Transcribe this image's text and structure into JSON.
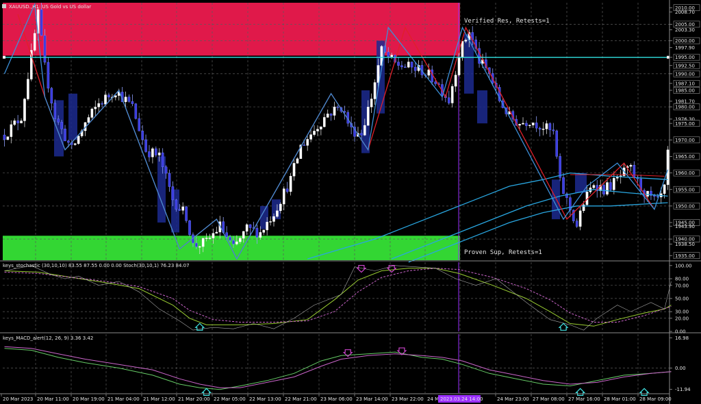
{
  "header": {
    "title": "XAUUSD.,H1:  US Gold vs US dollar",
    "stoch_title": "keys_stochastic (30,10,10) 83.55 87.55 0.00 0.00 Stoch(30,10,1) 76.23 84.07",
    "macd_title": "keys_MACD_alert(12, 26, 9) 3.36 3.42"
  },
  "zones": {
    "resistance_label": "Verified Res, Retests=1",
    "support_label": "Proven Sup, Retests=1"
  },
  "colors": {
    "background": "#000000",
    "resistance": "#e0194a",
    "support": "#33d633",
    "bull": "#ffffff",
    "bear": "#3b3bdf",
    "zigzag_red": "#e0202a",
    "zigzag_blue": "#3c8fd8",
    "ma": "#29a6e0",
    "hline": "#30e0e0",
    "stoch_main": "#9acd32",
    "stoch_signal": "#cc66cc",
    "macd_main": "#66cc66",
    "macd_signal": "#cc66cc",
    "arrow_up": "#40e0e0",
    "arrow_down": "#cc44cc"
  },
  "cursor_label": "2023.03.24 14:00",
  "chart_data": [
    {
      "type": "candlestick",
      "title": "XAUUSD.,H1:  US Gold vs US dollar",
      "ylim": [
        1933.6,
        2011.5
      ],
      "y_ticks": [
        "2010.00",
        "2008.70",
        "2005.00",
        "2003.30",
        "2000.00",
        "1997.90",
        "1995.00",
        "1992.50",
        "1990.00",
        "1987.10",
        "1985.00",
        "1981.70",
        "1980.00",
        "1976.30",
        "1975.00",
        "1970.00",
        "1965.00",
        "1960.00",
        "1955.00",
        "1950.00",
        "1945.00",
        "1943.90",
        "1940.00",
        "1938.50",
        "1935.00"
      ],
      "x_ticks": [
        "20 Mar 2023",
        "20 Mar 11:00",
        "20 Mar 19:00",
        "21 Mar 04:00",
        "21 Mar 12:00",
        "21 Mar 20:00",
        "22 Mar 05:00",
        "22 Mar 13:00",
        "22 Mar 21:00",
        "23 Mar 06:00",
        "23 Mar 14:00",
        "23 Mar 22:00",
        "24 Mar 23:00",
        "27 Mar 08:00",
        "27 Mar 16:00",
        "28 Mar 01:00",
        "28 Mar 09:00"
      ],
      "resistance_zone": [
        1995.5,
        2011.5
      ],
      "support_zone": [
        1933.6,
        1941.0
      ],
      "hline": 1995.0,
      "price_anchors": [
        [
          0,
          1971.5
        ],
        [
          5,
          1977
        ],
        [
          10,
          2008
        ],
        [
          12,
          1992
        ],
        [
          15,
          1977
        ],
        [
          20,
          1967
        ],
        [
          24,
          1975
        ],
        [
          28,
          1981
        ],
        [
          33,
          1985
        ],
        [
          38,
          1980
        ],
        [
          42,
          1967
        ],
        [
          46,
          1965
        ],
        [
          50,
          1952
        ],
        [
          54,
          1947
        ],
        [
          56,
          1938
        ],
        [
          60,
          1939
        ],
        [
          64,
          1944
        ],
        [
          68,
          1937
        ],
        [
          72,
          1943
        ],
        [
          76,
          1942
        ],
        [
          80,
          1948
        ],
        [
          85,
          1958
        ],
        [
          88,
          1968
        ],
        [
          92,
          1973
        ],
        [
          96,
          1978
        ],
        [
          100,
          1980
        ],
        [
          103,
          1973
        ],
        [
          106,
          1972
        ],
        [
          109,
          1983
        ],
        [
          112,
          1997
        ],
        [
          116,
          1993
        ],
        [
          120,
          1992
        ],
        [
          124,
          1991
        ],
        [
          128,
          1988
        ],
        [
          132,
          1982
        ],
        [
          135,
          1996
        ],
        [
          138,
          2003
        ],
        [
          141,
          1994
        ],
        [
          144,
          1990
        ],
        [
          147,
          1982
        ],
        [
          150,
          1977
        ],
        [
          153,
          1975
        ],
        [
          156,
          1976
        ],
        [
          160,
          1974
        ],
        [
          163,
          1972
        ],
        [
          165,
          1957
        ],
        [
          168,
          1949
        ],
        [
          170,
          1944
        ],
        [
          172,
          1951
        ],
        [
          175,
          1957
        ],
        [
          178,
          1955
        ],
        [
          181,
          1957
        ],
        [
          184,
          1960
        ],
        [
          186,
          1961
        ],
        [
          188,
          1957
        ],
        [
          191,
          1953
        ],
        [
          194,
          1951
        ],
        [
          196,
          1955
        ],
        [
          197,
          1966
        ]
      ],
      "zigzag_red": [
        [
          4,
          2008
        ],
        [
          12,
          1983
        ],
        [
          18,
          1967
        ],
        [
          34,
          1985
        ],
        [
          52,
          1937
        ],
        [
          63,
          1946
        ],
        [
          69,
          1934
        ],
        [
          97,
          1984
        ],
        [
          108,
          1967
        ],
        [
          119,
          2004
        ],
        [
          131,
          1983
        ],
        [
          137,
          2004
        ],
        [
          167,
          1946
        ],
        [
          184,
          1963
        ],
        [
          193,
          1949
        ]
      ],
      "zigzag_blue": [
        [
          0,
          1990
        ],
        [
          9,
          2011
        ],
        [
          12,
          1983
        ],
        [
          18,
          1967
        ],
        [
          34,
          1985
        ],
        [
          52,
          1937
        ],
        [
          63,
          1946
        ],
        [
          69,
          1934
        ],
        [
          97,
          1984
        ],
        [
          108,
          1967
        ],
        [
          114,
          2004
        ],
        [
          130,
          1983
        ],
        [
          136,
          2004
        ],
        [
          166,
          1946
        ],
        [
          173,
          1956
        ],
        [
          182,
          1963
        ],
        [
          193,
          1949
        ],
        [
          197,
          1961
        ]
      ],
      "ma1": [
        [
          90,
          1934
        ],
        [
          100,
          1937
        ],
        [
          110,
          1940
        ],
        [
          120,
          1944
        ],
        [
          130,
          1948
        ],
        [
          140,
          1952
        ],
        [
          150,
          1956
        ],
        [
          160,
          1958
        ],
        [
          168,
          1960
        ],
        [
          180,
          1959
        ],
        [
          197,
          1958
        ]
      ],
      "ma2": [
        [
          115,
          1934
        ],
        [
          125,
          1938
        ],
        [
          135,
          1942
        ],
        [
          145,
          1946
        ],
        [
          155,
          1950
        ],
        [
          165,
          1953
        ],
        [
          175,
          1955
        ],
        [
          185,
          1954
        ],
        [
          197,
          1953
        ]
      ],
      "ma3": [
        [
          120,
          1933
        ],
        [
          130,
          1937
        ],
        [
          140,
          1941
        ],
        [
          150,
          1945
        ],
        [
          160,
          1948
        ],
        [
          170,
          1950
        ],
        [
          180,
          1950
        ],
        [
          197,
          1951
        ]
      ]
    },
    {
      "type": "line",
      "title": "keys_stochastic (30,10,10) 83.55 87.55 0.00 0.00 Stoch(30,10,1) 76.23 84.07",
      "ylim": [
        0,
        105
      ],
      "y_ticks": [
        "100.00",
        "80.00",
        "70.00",
        "50.00",
        "30.00",
        "20.00",
        "0.00"
      ],
      "series": [
        {
          "values": [
            [
              0,
              92
            ],
            [
              10,
              90
            ],
            [
              20,
              82
            ],
            [
              30,
              74
            ],
            [
              40,
              65
            ],
            [
              50,
              40
            ],
            [
              55,
              20
            ],
            [
              60,
              10
            ],
            [
              70,
              10
            ],
            [
              80,
              12
            ],
            [
              90,
              18
            ],
            [
              98,
              48
            ],
            [
              105,
              78
            ],
            [
              112,
              92
            ],
            [
              120,
              96
            ],
            [
              128,
              96
            ],
            [
              135,
              88
            ],
            [
              145,
              70
            ],
            [
              155,
              50
            ],
            [
              162,
              30
            ],
            [
              168,
              12
            ],
            [
              175,
              8
            ],
            [
              182,
              18
            ],
            [
              190,
              28
            ],
            [
              196,
              34
            ],
            [
              198,
              40
            ]
          ]
        },
        {
          "values": [
            [
              0,
              90
            ],
            [
              10,
              88
            ],
            [
              20,
              82
            ],
            [
              30,
              76
            ],
            [
              40,
              68
            ],
            [
              50,
              50
            ],
            [
              55,
              32
            ],
            [
              62,
              18
            ],
            [
              70,
              14
            ],
            [
              80,
              14
            ],
            [
              90,
              16
            ],
            [
              98,
              30
            ],
            [
              105,
              60
            ],
            [
              112,
              82
            ],
            [
              120,
              92
            ],
            [
              128,
              96
            ],
            [
              135,
              94
            ],
            [
              145,
              82
            ],
            [
              155,
              65
            ],
            [
              162,
              48
            ],
            [
              168,
              28
            ],
            [
              175,
              14
            ],
            [
              182,
              14
            ],
            [
              190,
              24
            ],
            [
              198,
              38
            ]
          ]
        },
        {
          "values": [
            [
              0,
              92
            ],
            [
              8,
              100
            ],
            [
              14,
              86
            ],
            [
              18,
              80
            ],
            [
              22,
              84
            ],
            [
              28,
              70
            ],
            [
              34,
              76
            ],
            [
              40,
              60
            ],
            [
              46,
              34
            ],
            [
              52,
              16
            ],
            [
              56,
              2
            ],
            [
              62,
              6
            ],
            [
              68,
              4
            ],
            [
              74,
              12
            ],
            [
              80,
              4
            ],
            [
              86,
              20
            ],
            [
              92,
              40
            ],
            [
              100,
              56
            ],
            [
              104,
              98
            ],
            [
              110,
              92
            ],
            [
              116,
              100
            ],
            [
              122,
              98
            ],
            [
              128,
              96
            ],
            [
              134,
              80
            ],
            [
              140,
              70
            ],
            [
              146,
              80
            ],
            [
              150,
              64
            ],
            [
              156,
              40
            ],
            [
              162,
              18
            ],
            [
              168,
              10
            ],
            [
              172,
              2
            ],
            [
              176,
              20
            ],
            [
              182,
              40
            ],
            [
              186,
              30
            ],
            [
              192,
              44
            ],
            [
              196,
              34
            ],
            [
              198,
              76
            ]
          ]
        }
      ],
      "arrows_down": [
        [
          106,
          94
        ],
        [
          115,
          94
        ]
      ],
      "arrows_up": [
        [
          58,
          8
        ],
        [
          166,
          8
        ]
      ]
    },
    {
      "type": "line",
      "title": "keys_MACD_alert(12, 26, 9) 3.36 3.42",
      "ylim": [
        -14,
        19
      ],
      "y_ticks": [
        "16.98",
        "0.00",
        "-11.94"
      ],
      "series": [
        {
          "values": [
            [
              0,
              11
            ],
            [
              8,
              10
            ],
            [
              16,
              6
            ],
            [
              24,
              3
            ],
            [
              34,
              0
            ],
            [
              44,
              -4
            ],
            [
              52,
              -9
            ],
            [
              58,
              -11
            ],
            [
              64,
              -12
            ],
            [
              70,
              -10
            ],
            [
              78,
              -7
            ],
            [
              86,
              -3
            ],
            [
              94,
              4
            ],
            [
              100,
              7
            ],
            [
              108,
              8
            ],
            [
              116,
              9
            ],
            [
              124,
              6
            ],
            [
              130,
              5
            ],
            [
              136,
              2
            ],
            [
              144,
              -3
            ],
            [
              152,
              -6
            ],
            [
              160,
              -9
            ],
            [
              168,
              -10
            ],
            [
              176,
              -7
            ],
            [
              184,
              -4
            ],
            [
              192,
              -3
            ],
            [
              198,
              -2
            ]
          ]
        },
        {
          "values": [
            [
              0,
              12
            ],
            [
              8,
              11
            ],
            [
              16,
              8
            ],
            [
              24,
              5
            ],
            [
              34,
              2
            ],
            [
              44,
              -1
            ],
            [
              52,
              -6
            ],
            [
              58,
              -9
            ],
            [
              64,
              -11
            ],
            [
              70,
              -11
            ],
            [
              78,
              -8
            ],
            [
              86,
              -5
            ],
            [
              94,
              1
            ],
            [
              100,
              5
            ],
            [
              108,
              7
            ],
            [
              116,
              8
            ],
            [
              124,
              7
            ],
            [
              130,
              6
            ],
            [
              136,
              4
            ],
            [
              144,
              -1
            ],
            [
              152,
              -4
            ],
            [
              160,
              -7
            ],
            [
              168,
              -9
            ],
            [
              176,
              -8
            ],
            [
              184,
              -5
            ],
            [
              192,
              -3
            ],
            [
              198,
              -2
            ]
          ]
        }
      ],
      "arrows_down": [
        [
          102,
          8
        ],
        [
          118,
          9
        ]
      ],
      "arrows_up": [
        [
          60,
          -13
        ],
        [
          171,
          -13
        ],
        [
          190,
          -13
        ]
      ]
    }
  ]
}
